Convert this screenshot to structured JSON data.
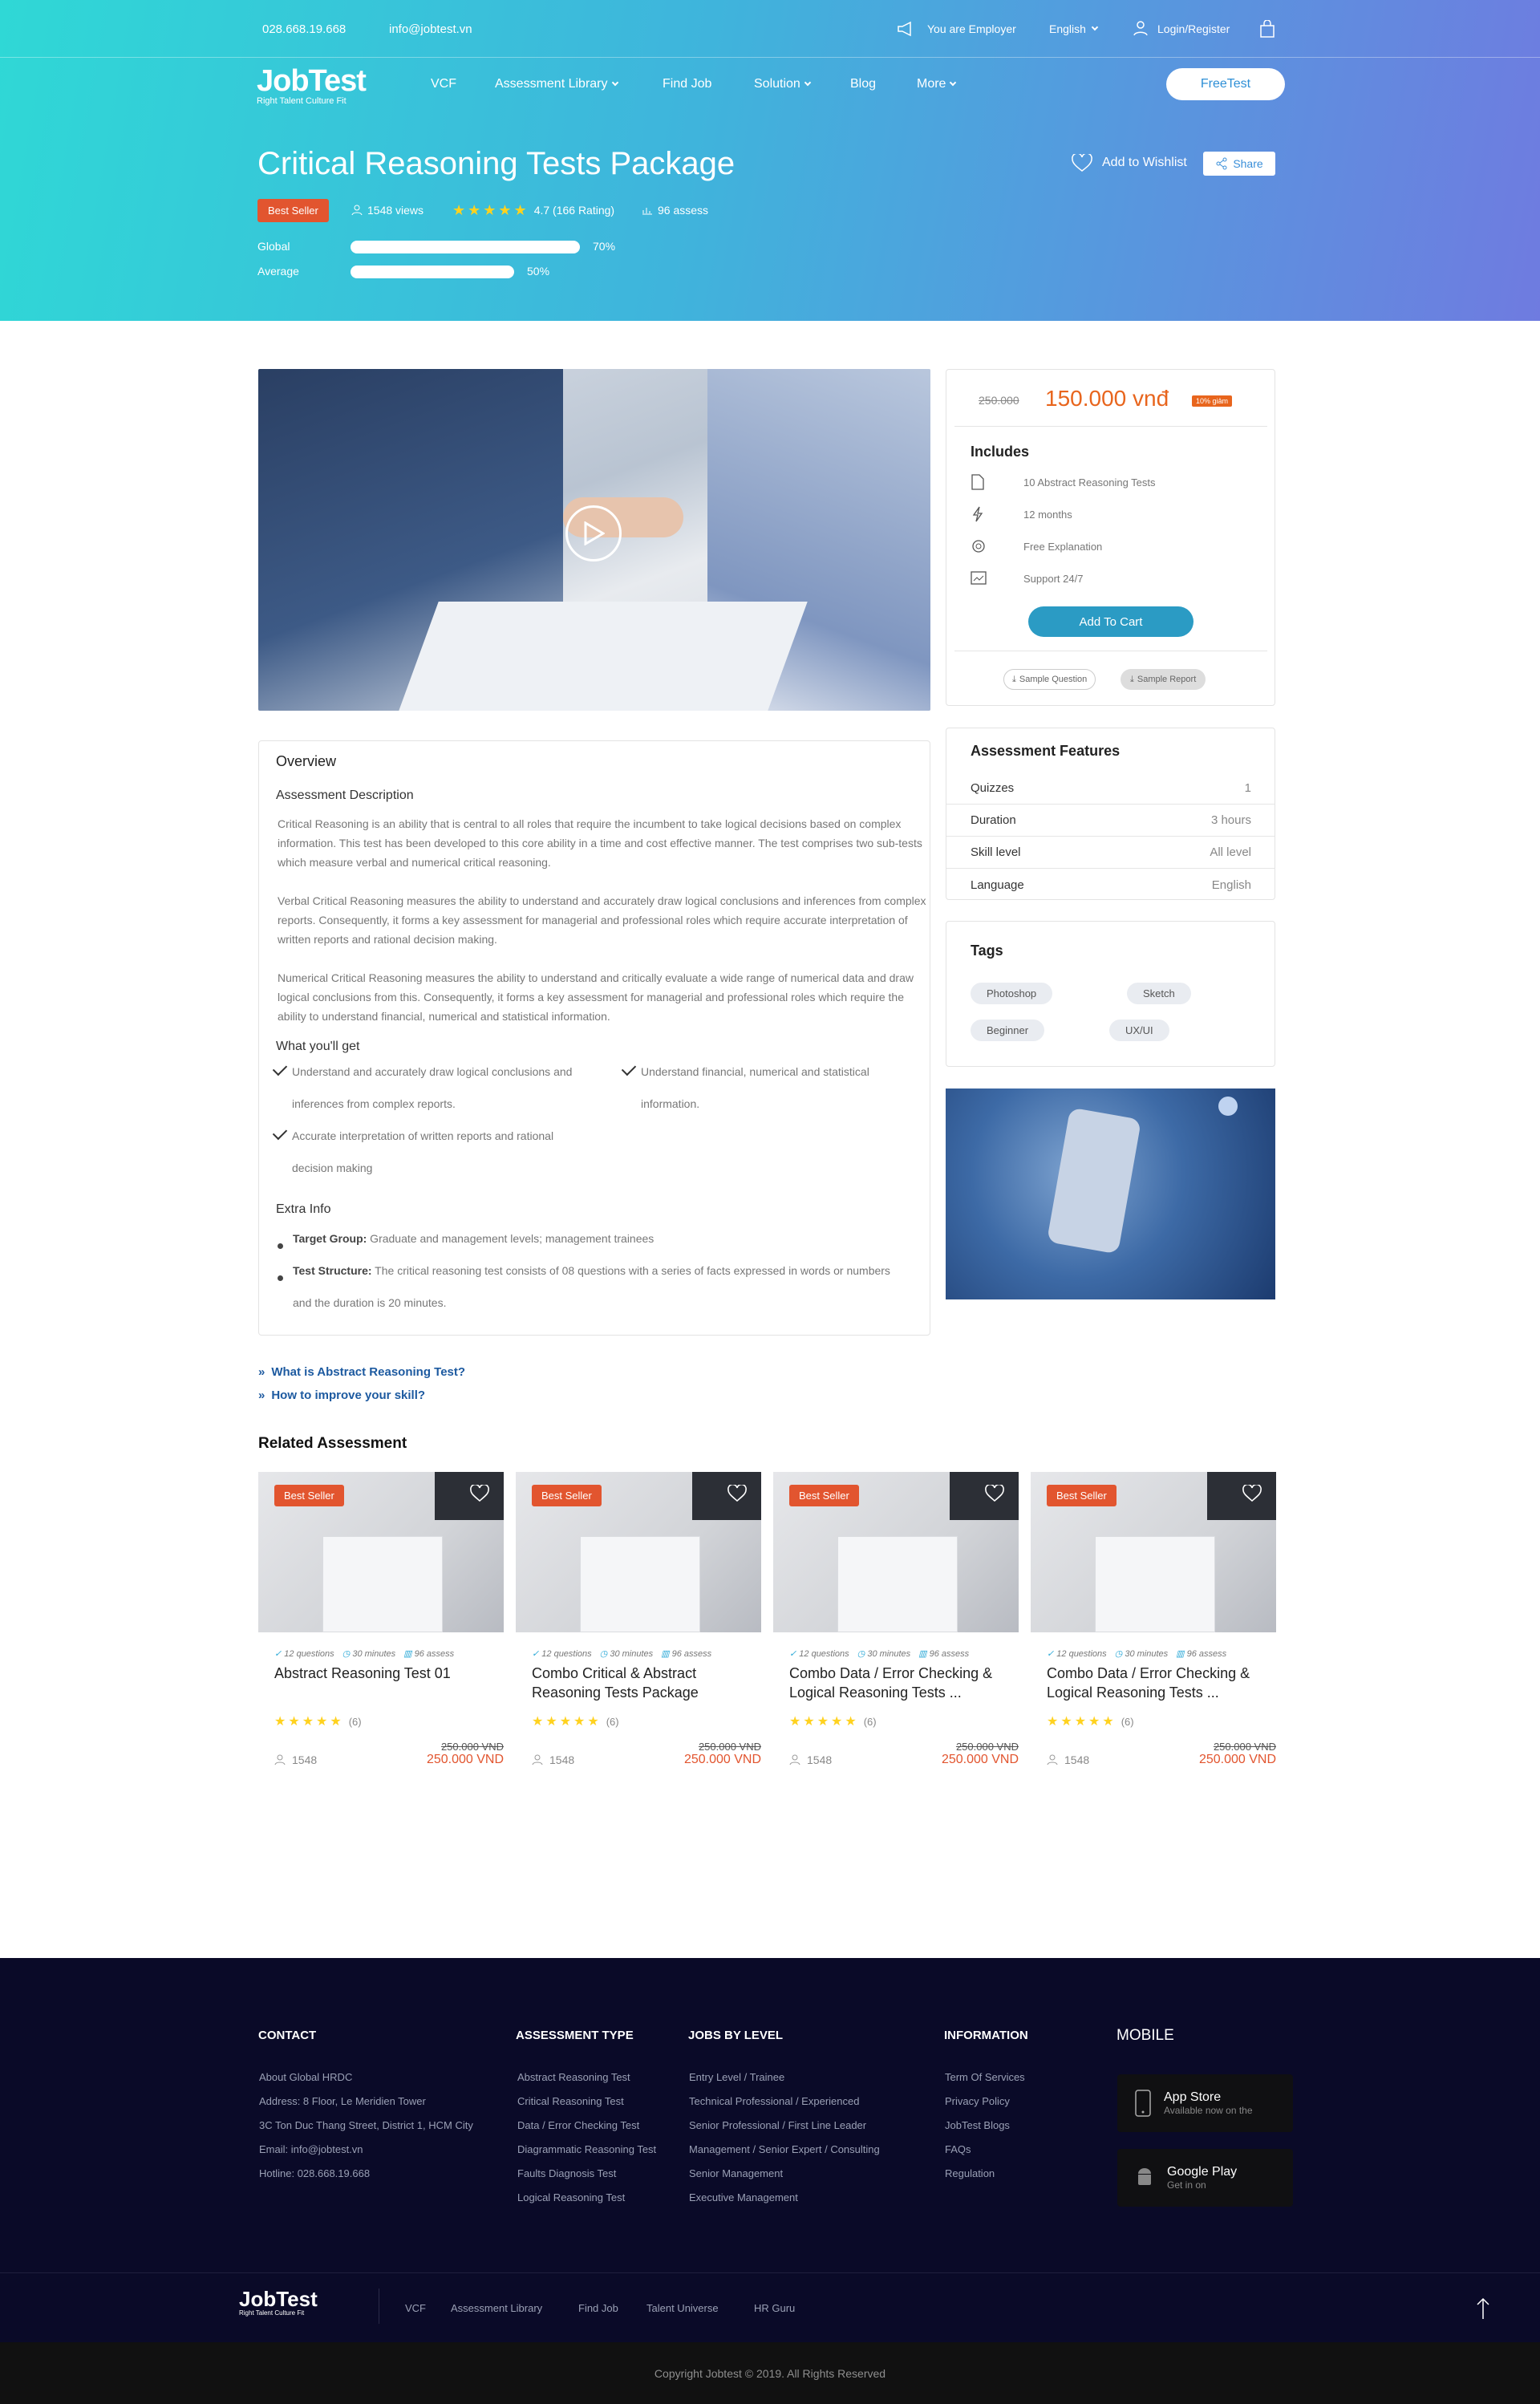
{
  "topbar": {
    "phone": "028.668.19.668",
    "email": "info@jobtest.vn",
    "employer": "You are Employer",
    "language": "English",
    "login": "Login/Register"
  },
  "brand": {
    "logo": "JobTest",
    "tagline": "Right Talent Culture Fit"
  },
  "nav": {
    "items": [
      "VCF",
      "Assessment Library",
      "Find Job",
      "Solution",
      "Blog",
      "More"
    ],
    "cta": "FreeTest"
  },
  "package": {
    "title": "Critical Reasoning Tests Package",
    "badge": "Best Seller",
    "views": "1548 views",
    "rating": "4.7 (166 Rating)",
    "assess": "96 assess",
    "wishlist": "Add to Wishlist",
    "share": "Share",
    "bars": [
      {
        "label": "Global",
        "value": 70,
        "text": "70%"
      },
      {
        "label": "Average",
        "value": 50,
        "text": "50%"
      }
    ]
  },
  "pricing": {
    "old": "250.000",
    "new": "150.000 vnđ",
    "discount": "10% giảm",
    "includes_title": "Includes",
    "includes": [
      "10 Abstract Reasoning Tests",
      "12 months",
      "Free Explanation",
      "Support 24/7"
    ],
    "cart": "Add To Cart",
    "sample_q": "Sample Question",
    "sample_r": "Sample Report"
  },
  "features": {
    "title": "Assessment Features",
    "rows": [
      {
        "k": "Quizzes",
        "v": "1"
      },
      {
        "k": "Duration",
        "v": "3 hours"
      },
      {
        "k": "Skill level",
        "v": "All level"
      },
      {
        "k": "Language",
        "v": "English"
      }
    ]
  },
  "tags": {
    "title": "Tags",
    "items": [
      "Photoshop",
      "Sketch",
      "Beginner",
      "UX/UI"
    ]
  },
  "overview": {
    "title": "Overview",
    "desc_title": "Assessment Description",
    "p1": "Critical Reasoning is an ability that is central to all roles that require the incumbent to take logical decisions based on complex information. This test has been developed to this core ability in a time and cost effective manner. The test comprises two sub-tests which measure verbal and numerical critical reasoning.",
    "p2": "Verbal Critical Reasoning measures the ability to understand and accurately draw logical conclusions and inferences from complex reports. Consequently, it forms a key assessment for managerial and professional roles which require accurate interpretation of written reports and rational decision making.",
    "p3": "Numerical Critical Reasoning measures the ability to understand and critically evaluate a wide range of numerical data and draw logical conclusions from this. Consequently, it forms a key assessment for managerial and professional roles which require the ability to understand financial, numerical and statistical information.",
    "get_title": "What you'll get",
    "get": [
      "Understand and accurately draw logical conclusions and inferences from complex reports.",
      "Understand financial, numerical and statistical information.",
      "Accurate interpretation of written reports and rational decision making"
    ],
    "extra_title": "Extra Info",
    "extra1_k": "Target Group:",
    "extra1_v": " Graduate and management levels; management trainees",
    "extra2_k": "Test Structure:",
    "extra2_v": " The critical reasoning test consists of 08 questions with a series of facts expressed in words or numbers and the duration is 20 minutes."
  },
  "links": [
    "What is Abstract Reasoning Test?",
    "How to improve your skill?"
  ],
  "related": {
    "title": "Related Assessment",
    "cards": [
      {
        "badge": "Best Seller",
        "questions": "12 questions",
        "minutes": "30 minutes",
        "assess": "96 assess",
        "title": "Abstract Reasoning Test 01",
        "reviews": "(6)",
        "users": "1548",
        "old": "250.000 VND",
        "price": "250.000 VND"
      },
      {
        "badge": "Best Seller",
        "questions": "12 questions",
        "minutes": "30 minutes",
        "assess": "96 assess",
        "title": "Combo Critical & Abstract Reasoning Tests Package",
        "reviews": "(6)",
        "users": "1548",
        "old": "250.000 VND",
        "price": "250.000 VND"
      },
      {
        "badge": "Best Seller",
        "questions": "12 questions",
        "minutes": "30 minutes",
        "assess": "96 assess",
        "title": "Combo Data / Error Checking & Logical Reasoning Tests ...",
        "reviews": "(6)",
        "users": "1548",
        "old": "250.000 VND",
        "price": "250.000 VND"
      },
      {
        "badge": "Best Seller",
        "questions": "12 questions",
        "minutes": "30 minutes",
        "assess": "96 assess",
        "title": "Combo Data / Error Checking & Logical Reasoning Tests ...",
        "reviews": "(6)",
        "users": "1548",
        "old": "250.000 VND",
        "price": "250.000 VND"
      }
    ]
  },
  "footer": {
    "contact_title": "CONTACT",
    "contact": [
      "About Global HRDC",
      "Address: 8 Floor, Le Meridien Tower",
      "3C Ton Duc Thang Street, District 1, HCM City",
      "Email: info@jobtest.vn",
      "Hotline: 028.668.19.668"
    ],
    "type_title": "ASSESSMENT TYPE",
    "types": [
      "Abstract Reasoning Test",
      "Critical Reasoning Test",
      "Data / Error Checking Test",
      "Diagrammatic Reasoning Test",
      "Faults Diagnosis Test",
      "Logical Reasoning Test"
    ],
    "level_title": "JOBS BY LEVEL",
    "levels": [
      "Entry Level / Trainee",
      "Technical Professional / Experienced",
      "Senior Professional / First Line Leader",
      "Management / Senior Expert / Consulting",
      "Senior Management",
      "Executive Management"
    ],
    "info_title": "INFORMATION",
    "info": [
      "Term Of Services",
      "Privacy Policy",
      "JobTest Blogs",
      "FAQs",
      "Regulation"
    ],
    "mobile_title": "MOBILE",
    "appstore": {
      "name": "App Store",
      "sub": "Available now on the"
    },
    "googleplay": {
      "name": "Google Play",
      "sub": "Get in on"
    },
    "bottom_links": [
      "VCF",
      "Assessment Library",
      "Find Job",
      "Talent Universe",
      "HR Guru"
    ],
    "copyright": "Copyright Jobtest © 2019.  All Rights Reserved"
  }
}
